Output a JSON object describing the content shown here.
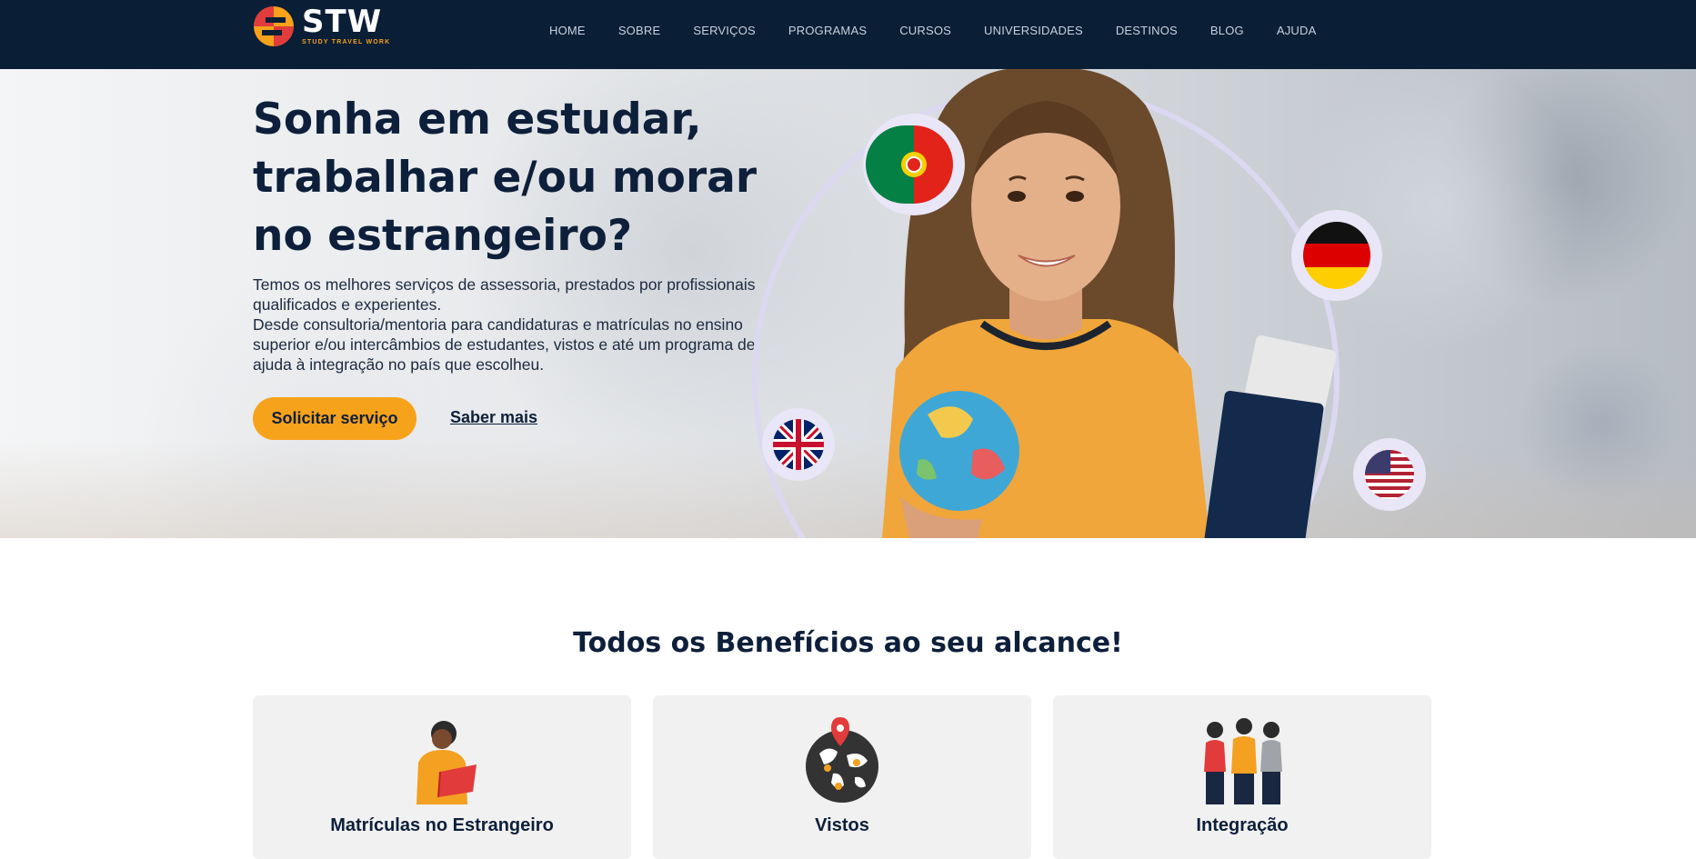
{
  "brand": {
    "name": "STW",
    "tagline": "STUDY TRAVEL WORK",
    "navy": "#0a1e36",
    "orange": "#f7a21b",
    "red": "#e23b3b"
  },
  "nav": {
    "items": [
      "HOME",
      "SOBRE",
      "SERVIÇOS",
      "PROGRAMAS",
      "CURSOS",
      "UNIVERSIDADES",
      "DESTINOS",
      "BLOG",
      "AJUDA"
    ]
  },
  "hero": {
    "title": "Sonha em estudar, trabalhar e/ou morar no estrangeiro?",
    "description_line1": "Temos os melhores serviços de assessoria, prestados por profissionais qualificados e experientes.",
    "description_line2": "Desde consultoria/mentoria para candidaturas e matrículas no ensino superior e/ou intercâmbios de estudantes, vistos e até um programa de ajuda à integração no país que escolheu.",
    "cta_primary": "Solicitar serviço",
    "cta_secondary": "Saber mais",
    "flags": [
      "portugal-flag-icon",
      "germany-flag-icon",
      "uk-flag-icon",
      "usa-flag-icon"
    ]
  },
  "benefits": {
    "title": "Todos os Benefícios ao seu alcance!",
    "cards": [
      {
        "title": "Matrículas no Estrangeiro",
        "icon": "student-reading-icon"
      },
      {
        "title": "Vistos",
        "icon": "world-map-pins-icon"
      },
      {
        "title": "Integração",
        "icon": "group-people-icon"
      }
    ]
  }
}
